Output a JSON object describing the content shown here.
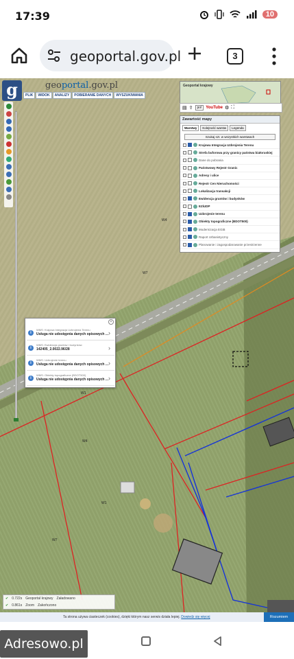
{
  "status_bar": {
    "time": "17:39",
    "battery": "10",
    "icons": [
      "alarm-icon",
      "vibrate-icon",
      "wifi-icon",
      "signal-icon",
      "battery-icon"
    ]
  },
  "browser": {
    "url": "geoportal.gov.pl",
    "tab_count": "3",
    "home_icon": "home-icon",
    "site_settings_icon": "tune-icon",
    "new_tab_icon": "plus-icon",
    "menu_icon": "more-vert-icon"
  },
  "geoportal": {
    "logo_letter": "g",
    "brand_prefix": "geo",
    "brand_main": "portal",
    "brand_suffix": ".gov.pl",
    "menu": [
      "PLIK",
      "WIDOK",
      "ANALIZY",
      "POBIERANIE DANYCH",
      "WYSZUKIWANIA"
    ],
    "overview_title": "Geoportal krajowy",
    "toolbar_select": "pol",
    "toolbar_youtube": "YouTube",
    "layer_panel": {
      "title": "Zawartość mapy",
      "tabs": [
        "Warstwy",
        "Kolejność warstw",
        "Legenda"
      ],
      "search_label": "Szukaj szt. w wszystkich warstwach",
      "layers": [
        {
          "label": "Krajowa Integracja Uzbrojenia Terenu",
          "checked": true,
          "bold": true
        },
        {
          "label": "Strefa buforowa przy granicy państwa białoruskiej",
          "checked": false,
          "bold": true
        },
        {
          "label": "Dane do pobrania",
          "checked": false,
          "bold": false
        },
        {
          "label": "Państwowy Rejestr Granic",
          "checked": false,
          "bold": true
        },
        {
          "label": "Adresy i ulice",
          "checked": false,
          "bold": true
        },
        {
          "label": "Rejestr Cen Nieruchomości",
          "checked": false,
          "bold": true
        },
        {
          "label": "Lokalizacja transakcji",
          "checked": false,
          "bold": true
        },
        {
          "label": "Ewidencja gruntów i budynków",
          "checked": true,
          "bold": true
        },
        {
          "label": "EZiUDP",
          "checked": false,
          "bold": true
        },
        {
          "label": "Uzbrojenie terenu",
          "checked": true,
          "bold": true
        },
        {
          "label": "Obiekty topograficzne (BDOT500)",
          "checked": true,
          "bold": true
        },
        {
          "label": "Modernizacja EGiB",
          "checked": true,
          "bold": false
        },
        {
          "label": "Raport Urbanistyczny",
          "checked": true,
          "bold": false
        },
        {
          "label": "Planowanie i zagospodarowanie przestrzenne",
          "checked": true,
          "bold": false
        }
      ]
    },
    "info_popup": {
      "items": [
        {
          "source": "WMS: Krajowa Integracja Uzbrojenia Terenu",
          "value": "Usługa nie udostępnia danych opisowych ..."
        },
        {
          "source": "WMS: Ewidencja gruntów i budynków",
          "value": "142405_2.0022.96/28"
        },
        {
          "source": "WMS: Uzbrojenie terenu",
          "value": "Usługa nie udostępnia danych opisowych ..."
        },
        {
          "source": "WMS: Obiekty topograficzne (BDOT500)",
          "value": "Usługa nie udostępnia danych opisowych ..."
        }
      ]
    },
    "status_rows": [
      {
        "value": "0.722s",
        "label": "Geoportal krajowy",
        "state": "Załadowano"
      },
      {
        "value": "0.861s",
        "label": "Zoom",
        "state": "Zakończono"
      }
    ],
    "cookie": {
      "text": "Ta strona używa ciasteczek (cookies), dzięki którym nasz serwis działa lepiej.",
      "link": "Dowiedz się więcej",
      "button": "Rozumiem"
    },
    "parcel_labels": [
      "W4",
      "W7",
      "W1",
      "W4",
      "W1",
      "W7"
    ]
  },
  "nav": {
    "overlay_brand": "Adresowo.pl"
  }
}
